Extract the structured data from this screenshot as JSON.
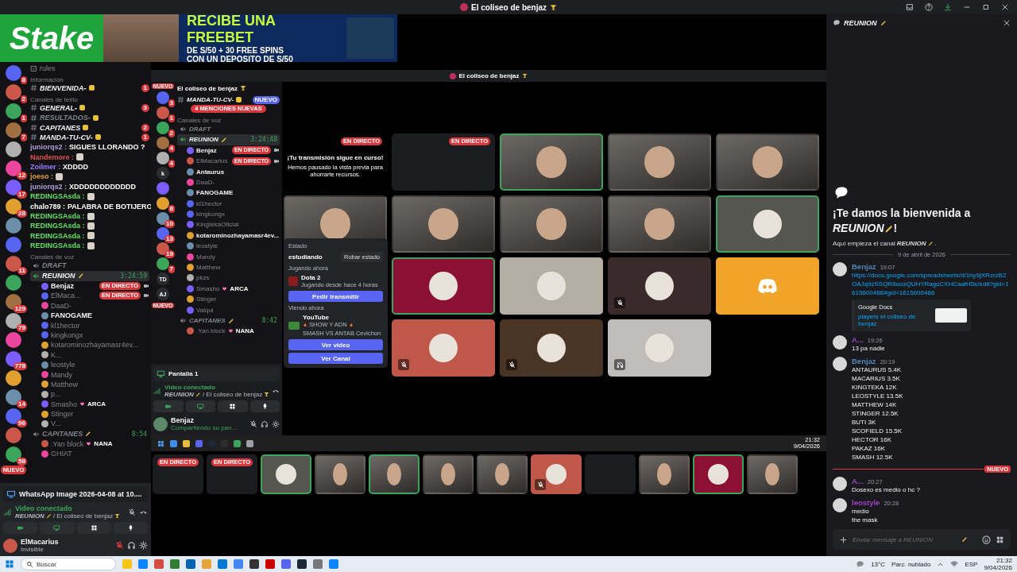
{
  "window": {
    "title": "El coliseo de benjaz"
  },
  "ad": {
    "brand": "Stake",
    "headline": "RECIBE UNA FREEBET",
    "line_1": "DE S/50 + 30 FREE SPINS",
    "line_2": "CON UN DEPOSITO DE S/50"
  },
  "left": {
    "servers": [
      {
        "kind": "badged",
        "badge": "8"
      },
      {
        "kind": "badged",
        "badge": "2"
      },
      {
        "kind": "badged",
        "badge": "1"
      },
      {
        "kind": "badged",
        "badge": "7"
      },
      {
        "kind": "plain"
      },
      {
        "kind": "badged",
        "badge": "12"
      },
      {
        "kind": "badged",
        "badge": "17"
      },
      {
        "kind": "badged",
        "badge": "28"
      },
      {
        "kind": "plain"
      },
      {
        "kind": "plain"
      },
      {
        "kind": "badged",
        "badge": "11"
      },
      {
        "kind": "plain"
      },
      {
        "kind": "badged",
        "badge": "129"
      },
      {
        "kind": "badged",
        "badge": "79"
      },
      {
        "kind": "plain"
      },
      {
        "kind": "badged",
        "badge": "778"
      },
      {
        "kind": "plain"
      },
      {
        "kind": "badged",
        "badge": "14"
      },
      {
        "kind": "badged",
        "badge": "96"
      },
      {
        "kind": "plain"
      },
      {
        "kind": "badged",
        "badge": "58"
      }
    ],
    "new_badge": "NUEVO",
    "channels": [
      {
        "kind": "link",
        "name": "rules"
      },
      {
        "kind": "category",
        "name": "Información"
      },
      {
        "kind": "text",
        "name": "BIENVENIDA-",
        "badge": "1",
        "unread": true
      },
      {
        "kind": "category",
        "name": "Canales de texto"
      },
      {
        "kind": "text",
        "name": "GENERAL-",
        "badge": "3",
        "unread": true
      },
      {
        "kind": "text",
        "name": "RESULTADOS-",
        "unread": false
      },
      {
        "kind": "text",
        "name": "CAPITANES",
        "badge": "2",
        "unread": true
      },
      {
        "kind": "text",
        "name": "MANDA-TU-CV-",
        "badge": "1",
        "unread": true
      },
      {
        "kind": "chat",
        "user": "juniorqs2 :",
        "text": "SIGUES LLORANDO ?",
        "color": "#b39ddb"
      },
      {
        "kind": "chat",
        "user": "Nandemore :",
        "emote": true,
        "color": "#e05050"
      },
      {
        "kind": "chat",
        "user": "Zoilmer :",
        "text": "XDDDD",
        "color": "#9b7dff"
      },
      {
        "kind": "chat",
        "user": "joeso :",
        "emote": true,
        "color": "#e0a040"
      },
      {
        "kind": "chat",
        "user": "juniorqs2 :",
        "text": "XDDDDDDDDDDDD",
        "color": "#b39ddb"
      },
      {
        "kind": "chat",
        "user": "REDINGSAsda :",
        "emote": true,
        "color": "#5ee05e"
      },
      {
        "kind": "chat",
        "user": "chalo789 :",
        "text": "PALABRA DE BOTIJERO",
        "color": "#ffffff"
      },
      {
        "kind": "chat",
        "user": "REDINGSAsda :",
        "emote": true,
        "color": "#5ee05e"
      },
      {
        "kind": "chat",
        "user": "REDINGSAsda :",
        "emote": true,
        "color": "#5ee05e"
      },
      {
        "kind": "chat",
        "user": "REDINGSAsda :",
        "emote": true,
        "color": "#5ee05e"
      },
      {
        "kind": "chat",
        "user": "REDINGSAsda :",
        "emote": true,
        "color": "#5ee05e"
      },
      {
        "kind": "category",
        "name": "Canales de voz"
      },
      {
        "kind": "voice",
        "name": "DRAFT",
        "selected": false
      },
      {
        "kind": "voice",
        "name": "REUNION",
        "time": "3:24:59",
        "selected": true,
        "members": true
      },
      {
        "kind": "member",
        "name": "Benjaz",
        "active": true,
        "live": "EN DIRECTO"
      },
      {
        "kind": "member",
        "name": "ElMaca...",
        "active": false,
        "live": "EN DIRECTO"
      },
      {
        "kind": "member",
        "name": "DaaD-",
        "active": false
      },
      {
        "kind": "member",
        "name": "FANOGAME",
        "active": true
      },
      {
        "kind": "member",
        "name": "kl1hector",
        "active": false
      },
      {
        "kind": "member",
        "name": "kingkongx",
        "active": false
      },
      {
        "kind": "member",
        "name": "kotarominozhayamasr4ev...",
        "active": false
      },
      {
        "kind": "member",
        "name": "K...",
        "active": false
      },
      {
        "kind": "member",
        "name": "leostyle",
        "active": false
      },
      {
        "kind": "member",
        "name": "Mandy",
        "active": false
      },
      {
        "kind": "member",
        "name": "Matthew",
        "active": false
      },
      {
        "kind": "member",
        "name": "p...",
        "active": false
      },
      {
        "kind": "member",
        "name": "Smasho",
        "active": false,
        "tag": "ARCA"
      },
      {
        "kind": "member",
        "name": "Stinger",
        "active": false
      },
      {
        "kind": "member",
        "name": "V...",
        "active": false
      },
      {
        "kind": "voice",
        "name": "CAPITANES",
        "time": "8:54",
        "selected": false,
        "members": true
      },
      {
        "kind": "member",
        "name": ".Yan block",
        "active": false,
        "tag": "NANA"
      },
      {
        "kind": "member",
        "name": "GHIAT",
        "active": false
      }
    ],
    "share": {
      "title": "WhatsApp Image 2026-04-08 at 10...."
    },
    "connection": {
      "status": "Video conectado",
      "channel": "REUNION",
      "separator": "/",
      "server": "El coliseo de benjaz"
    },
    "user": {
      "name": "ElMacarius",
      "status": "Invisible"
    }
  },
  "stream": {
    "title": "El coliseo de benjaz",
    "new_top": "NUEVO",
    "new_bottom": "NUEVO",
    "servers": [
      {
        "kind": "badged",
        "badge": "3"
      },
      {
        "kind": "badged",
        "badge": "1"
      },
      {
        "kind": "badged",
        "badge": "2"
      },
      {
        "kind": "badged",
        "badge": "4"
      },
      {
        "kind": "badged",
        "badge": "4"
      },
      {
        "kind": "initials",
        "label": "k"
      },
      {
        "kind": "plain"
      },
      {
        "kind": "badged",
        "badge": "8"
      },
      {
        "kind": "badged",
        "badge": "10"
      },
      {
        "kind": "badged",
        "badge": "13"
      },
      {
        "kind": "badged",
        "badge": "19"
      },
      {
        "kind": "badged",
        "badge": "7"
      },
      {
        "kind": "initials",
        "label": "TD"
      },
      {
        "kind": "initials",
        "label": "AJ"
      }
    ],
    "server_name": "El coliseo de benjaz",
    "channels": [
      {
        "kind": "text",
        "name": "MANDA-TU-CV-",
        "badge": "NUEVO",
        "unread": true
      },
      {
        "kind": "mentions",
        "name": "4 MENCIONES NUEVAS"
      },
      {
        "kind": "category",
        "name": "Canales de voz"
      },
      {
        "kind": "voice",
        "name": "DRAFT",
        "selected": false
      },
      {
        "kind": "voice",
        "name": "REUNION",
        "time": "3:24:48",
        "selected": true,
        "members": true
      },
      {
        "kind": "member",
        "name": "Benjaz",
        "active": true,
        "live": "EN DIRECTO"
      },
      {
        "kind": "member",
        "name": "ElMacarius",
        "active": false,
        "live": "EN DIRECTO"
      },
      {
        "kind": "member",
        "name": "Antaurus",
        "active": true
      },
      {
        "kind": "member",
        "name": "DaaD-",
        "active": false
      },
      {
        "kind": "member",
        "name": "FANOGAME",
        "active": true
      },
      {
        "kind": "member",
        "name": "kl1hector",
        "active": false
      },
      {
        "kind": "member",
        "name": "kingkongx",
        "active": false
      },
      {
        "kind": "member",
        "name": "KingtekaOficial",
        "active": false
      },
      {
        "kind": "member",
        "name": "kotarominozhayamasr4ev...",
        "active": true
      },
      {
        "kind": "member",
        "name": "leostyle",
        "active": false
      },
      {
        "kind": "member",
        "name": "Mandy",
        "active": false
      },
      {
        "kind": "member",
        "name": "Matthew",
        "active": false
      },
      {
        "kind": "member",
        "name": "pkzs",
        "active": false
      },
      {
        "kind": "member",
        "name": "Smasho",
        "active": false,
        "tag": "ARCA"
      },
      {
        "kind": "member",
        "name": "Stinger",
        "active": false
      },
      {
        "kind": "member",
        "name": "Valqui",
        "active": false
      },
      {
        "kind": "voice",
        "name": "CAPITANES",
        "time": "8:42",
        "selected": false,
        "members": true
      },
      {
        "kind": "member",
        "name": ".Yan block",
        "active": false,
        "tag": "NANA"
      }
    ],
    "share": {
      "title": "Pantalla 1"
    },
    "connection": {
      "status": "Video conectado",
      "channel": "REUNION",
      "separator": "/",
      "server": "El coliseo de benjaz"
    },
    "user": {
      "name": "Benjaz",
      "status": "Compartiendo su pan..."
    },
    "tiles": [
      {
        "kind": "notice",
        "live": "EN DIRECTO",
        "title": "¡Tu transmisión sigue en curso!",
        "text": "Hemos pausado la vista previa para ahorrarte recursos.",
        "speaking": false,
        "muted": false,
        "deafened": false
      },
      {
        "kind": "screen",
        "live": "EN DIRECTO",
        "speaking": false,
        "muted": false,
        "deafened": false
      },
      {
        "kind": "camera",
        "speaking": true,
        "muted": false,
        "deafened": false
      },
      {
        "kind": "camera",
        "speaking": false,
        "muted": false,
        "deafened": false
      },
      {
        "kind": "camera",
        "speaking": false,
        "muted": false,
        "deafened": false
      },
      {
        "kind": "camera",
        "speaking": false,
        "muted": false,
        "deafened": false
      },
      {
        "kind": "camera",
        "speaking": false,
        "muted": false,
        "deafened": false
      },
      {
        "kind": "camera",
        "speaking": false,
        "muted": false,
        "deafened": false
      },
      {
        "kind": "camera",
        "speaking": false,
        "muted": false,
        "deafened": false
      },
      {
        "kind": "avatar",
        "color": "#55564f",
        "speaking": true,
        "muted": false,
        "deafened": false
      },
      {
        "kind": "empty"
      },
      {
        "kind": "avatar",
        "color": "#8a1034",
        "speaking": true,
        "muted": false,
        "deafened": false
      },
      {
        "kind": "avatar",
        "color": "#b5aea3",
        "speaking": false,
        "muted": false,
        "deafened": false
      },
      {
        "kind": "avatar",
        "color": "#3a2a2c",
        "speaking": false,
        "muted": true,
        "deafened": false
      },
      {
        "kind": "logo",
        "color": "#f0a52a",
        "speaking": false,
        "muted": false,
        "deafened": false
      },
      {
        "kind": "empty"
      },
      {
        "kind": "avatar",
        "color": "#c0584a",
        "speaking": false,
        "muted": true,
        "deafened": false
      },
      {
        "kind": "avatar",
        "color": "#4a3524",
        "speaking": false,
        "muted": true,
        "deafened": false
      },
      {
        "kind": "avatar",
        "color": "#c0bcba",
        "speaking": false,
        "muted": false,
        "deafened": true
      }
    ],
    "popup": {
      "status_label": "Estado",
      "status": "estudiando",
      "steal": "Robar estado",
      "playing_label": "Jugando ahora",
      "game": "Dota 2",
      "game_time": "Jugando desde hace 4 horas",
      "ask": "Pedir transmitir",
      "watching_label": "Viendo ahora",
      "app": "YouTube",
      "video_parts": [
        "SHOW Y ADN",
        "SMASH VS ANTAB"
      ],
      "video_channel": "Cevichon",
      "watch": "Ver video",
      "channel_button": "Ver Canal"
    },
    "taskbar": {
      "time": "21:32",
      "date": "9/04/2026"
    },
    "thumbnails": [
      {
        "kind": "screen",
        "live": "EN DIRECTO",
        "speaking": false,
        "muted": false,
        "deafened": false
      },
      {
        "kind": "screen",
        "live": "EN DIRECTO",
        "speaking": false,
        "muted": false,
        "deafened": false
      },
      {
        "kind": "avatar",
        "color": "#55564f",
        "speaking": true,
        "muted": false,
        "deafened": false
      },
      {
        "kind": "camera",
        "speaking": false,
        "muted": false,
        "deafened": false
      },
      {
        "kind": "camera",
        "speaking": true,
        "muted": false,
        "deafened": false
      },
      {
        "kind": "camera",
        "speaking": false,
        "muted": false,
        "deafened": false
      },
      {
        "kind": "camera",
        "speaking": false,
        "muted": false,
        "deafened": false
      },
      {
        "kind": "avatar",
        "color": "#c0584a",
        "speaking": false,
        "muted": true,
        "deafened": false
      },
      {
        "kind": "screen",
        "speaking": false,
        "muted": false,
        "deafened": false
      },
      {
        "kind": "camera",
        "speaking": false,
        "muted": false,
        "deafened": false
      },
      {
        "kind": "avatar",
        "color": "#8a1034",
        "speaking": true,
        "muted": false,
        "deafened": false
      },
      {
        "kind": "camera",
        "speaking": false,
        "muted": false,
        "deafened": false
      }
    ]
  },
  "chat": {
    "title": "REUNION",
    "welcome": "¡Te damos la bienvenida a",
    "channel": "REUNION",
    "welcome_end": "!",
    "intro": "Aquí empieza el canal",
    "intro_channel": "REUNION",
    "intro_end": ".",
    "date": "9 de abril de 2026",
    "messages": [
      {
        "kind": "message",
        "author": "Benjaz",
        "color": "#4f86b8",
        "time": "19:07",
        "link": "https://docs.google.com/spreadsheets/d/1hy9jXRzrzB2OAJq9cSSQR6oozQUHYRagcCXHCaafH5c/edit?gid=1615600466#gid=1615600466",
        "embed": {
          "provider": "Google Docs",
          "title": "players el coliseo de benjaz"
        }
      },
      {
        "kind": "message",
        "author": "A...",
        "color": "#8e44c0",
        "time": "19:26",
        "lines": [
          "13 pa nadie"
        ]
      },
      {
        "kind": "message",
        "author": "Benjaz",
        "color": "#4f86b8",
        "time": "20:19",
        "lines": [
          "ANTAURUS 5.4K",
          "MACARIUS 3.5K",
          "KINGTEKA 12K",
          "LEOSTYLE 13.5K",
          "MATTHEW  14K",
          "STINGER 12.5K",
          "BUTI  3K",
          "SCOFIELD 15.5K",
          "HECTOR 16K",
          "PAKAZ 16K",
          "SMASH 12.5K"
        ]
      },
      {
        "kind": "divider",
        "label": "NUEVO"
      },
      {
        "kind": "message",
        "author": "A...",
        "color": "#8e44c0",
        "time": "20:27",
        "lines": [
          "Dosexo es medio o hc ?"
        ]
      },
      {
        "kind": "message",
        "author": "leostyle",
        "color": "#a040c0",
        "time": "20:28",
        "lines": [
          "medio",
          "the mask"
        ]
      }
    ],
    "placeholder": "Enviar mensaje a REUNION"
  },
  "taskbar": {
    "placeholder": "Buscar",
    "temperature": "13°C",
    "weather": "Parc. nublado",
    "language": "ESP",
    "time": "21:32",
    "date": "9/04/2026"
  }
}
